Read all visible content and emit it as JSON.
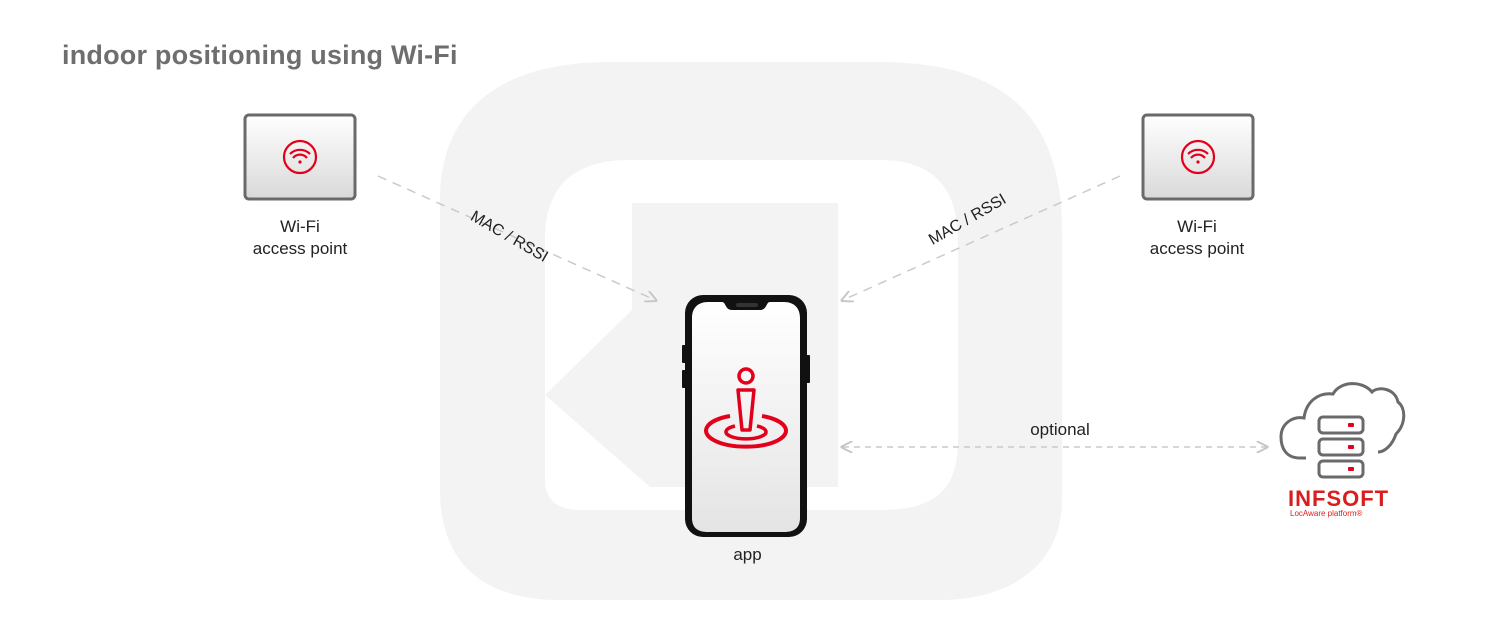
{
  "title": "indoor positioning using Wi-Fi",
  "access_points": [
    {
      "line1": "Wi-Fi",
      "line2": "access point"
    },
    {
      "line1": "Wi-Fi",
      "line2": "access point"
    }
  ],
  "signal_labels": [
    "MAC / RSSI",
    "MAC / RSSI"
  ],
  "app_label": "app",
  "optional_label": "optional",
  "brand": {
    "name": "INFSOFT",
    "subtitle": "LocAware platform®"
  },
  "colors": {
    "accent": "#e2001a",
    "line": "#c8c8c8",
    "title": "#6e6e6e",
    "background_shape": "#f3f3f3"
  },
  "icons": [
    "wifi-icon",
    "wifi-icon",
    "smartphone-icon",
    "location-person-icon",
    "cloud-server-icon"
  ]
}
